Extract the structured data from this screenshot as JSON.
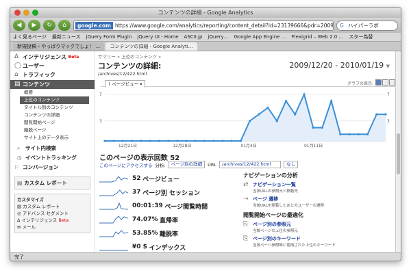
{
  "window": {
    "title": "コンテンツの詳細 - Google Analytics"
  },
  "toolbar": {
    "site": "google.com",
    "url": "https://www.google.com/analytics/reporting/content_detail?id=23139666&pdr=20091220-2010011",
    "search": "ハイパーラボ"
  },
  "bookmarks": [
    "よく見るページ",
    "最新ニュース",
    "jQuery Form Plugin",
    "jQuery UI - Home",
    "ASCII.jp",
    "jQuery…",
    "Google App Engine …",
    "Flexigrid – Web 2.0 …",
    "スター為替"
  ],
  "tabs": [
    "新規投稿 ‹ やっぱりマックでしょ！ …",
    "コンテンツの詳細 - Google Analyti…"
  ],
  "sidebar": {
    "top": [
      {
        "label": "インテリジェンス",
        "badge": "Beta",
        "icon": "∆"
      },
      {
        "label": "ユーザー",
        "icon": "◯"
      },
      {
        "label": "トラフィック",
        "icon": "⌂"
      }
    ],
    "current": "コンテンツ",
    "subs": [
      "概要",
      "上位のコンテンツ",
      "タイトル別のコンテンツ",
      "コンテンツの詳細",
      "閲覧開始ページ",
      "離脱ページ",
      "サイト上のデータ表示"
    ],
    "sections": [
      "サイト内検索",
      "イベントトラッキング",
      "コンバージョン"
    ],
    "custom_report": "カスタム レポート",
    "customize": {
      "title": "カスタマイズ",
      "items": [
        "カスタム レポート",
        "アドバンス セグメント",
        "インテリジェンス",
        "メール"
      ],
      "beta": "Beta"
    }
  },
  "main": {
    "breadcrumb": "サマリー » 上位のコンテンツ »",
    "title": "コンテンツの詳細:",
    "url": "/archives/12/422.html",
    "date_range": "2009/12/20 - 2010/01/19",
    "graph_tab": "ページビュー",
    "graph_mode": "グラフの表示:",
    "section_title": "このページの表示回数 52",
    "filters": {
      "link": "このページにアクセスする",
      "analysis": "分析:",
      "analysis_value": "ページ別の詳細",
      "url_label": "URL",
      "url_value": "/archives/12/422.html",
      "none": "なし"
    }
  },
  "metrics": [
    {
      "value": "52",
      "label": "ページビュー"
    },
    {
      "value": "37",
      "label": "ページ別 セッション"
    },
    {
      "value": "00:01:39",
      "label": "ページ閲覧時間"
    },
    {
      "value": "74.07%",
      "label": "直帰率"
    },
    {
      "value": "53.85%",
      "label": "離脱率"
    },
    {
      "value": "¥0 $",
      "label": "インデックス"
    }
  ],
  "navigation": {
    "title": "ナビゲーションの分析",
    "items": [
      {
        "link": "ナビゲーション一覧",
        "desc": "当該URLの参照元と移動先"
      },
      {
        "link": "ページ 遷移",
        "desc": "当該URLを閲覧したあとのユーザーの遷移"
      }
    ]
  },
  "landing": {
    "title": "閲覧開始ページの最適化",
    "items": [
      {
        "link": "ページ別の参照元",
        "desc": "当該ページの上位の参照元"
      },
      {
        "link": "ページ別のキーワード",
        "desc": "当該ページ参照時に使用された上位のキーワード"
      }
    ]
  },
  "status": "完了",
  "chart_data": {
    "type": "area",
    "xlabels": [
      "12月21日",
      "12月28日",
      "01月4日",
      "01月11日"
    ],
    "yticks": [
      3,
      7
    ],
    "ylim": [
      0,
      7
    ],
    "values": [
      0,
      0,
      0,
      0,
      0,
      0,
      0,
      0,
      0,
      0,
      0,
      0,
      0,
      0,
      0,
      0,
      3,
      4,
      5,
      3,
      6,
      4,
      7,
      2,
      2,
      6,
      1,
      1,
      1,
      1,
      4,
      4
    ],
    "color": "#3b8fd6"
  }
}
